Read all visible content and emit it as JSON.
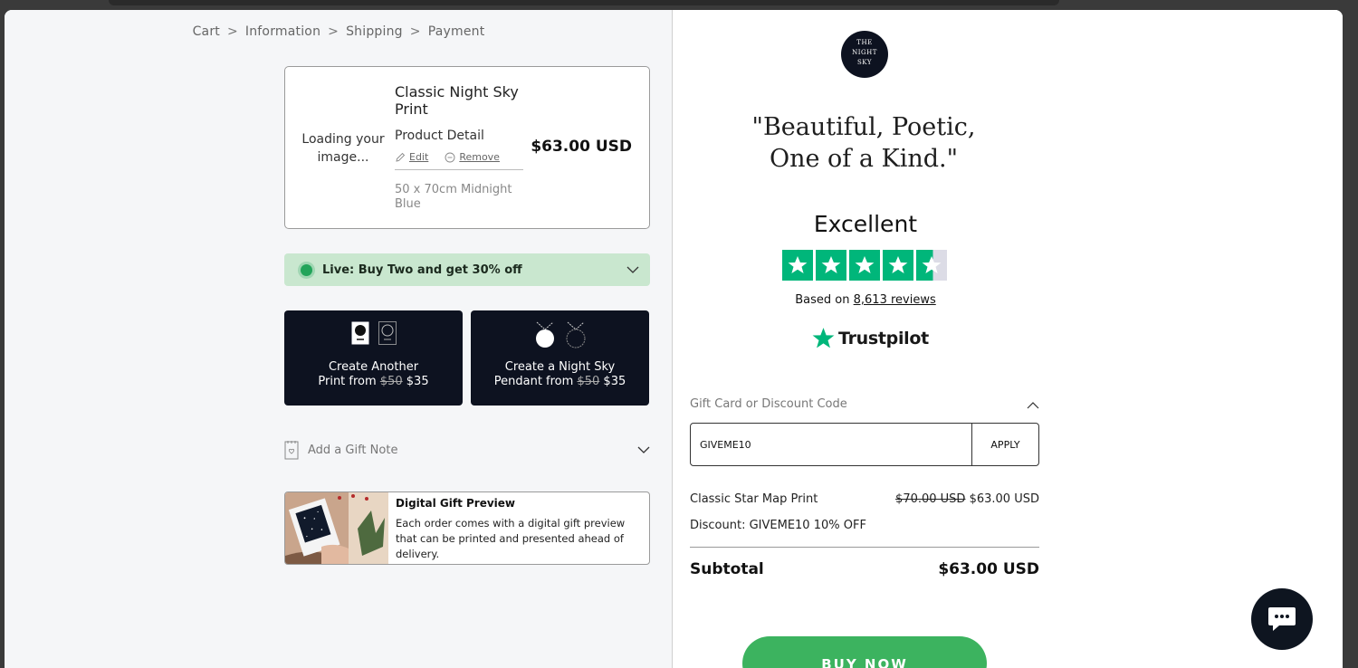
{
  "breadcrumb": {
    "items": [
      "Cart",
      "Information",
      "Shipping",
      "Payment"
    ],
    "separator": ">"
  },
  "product": {
    "loading_text": "Loading your image...",
    "title": "Classic Night Sky Print",
    "detail_label": "Product Detail",
    "edit_label": "Edit",
    "remove_label": "Remove",
    "variant": "50 x 70cm Midnight Blue",
    "price": "$63.00 USD"
  },
  "promo": {
    "label": "Live: Buy Two and get 30% off"
  },
  "upsells": [
    {
      "line1": "Create Another",
      "line2_prefix": "Print from",
      "old_price": "$50",
      "new_price": "$35"
    },
    {
      "line1": "Create a Night Sky",
      "line2_prefix": "Pendant from",
      "old_price": "$50",
      "new_price": "$35"
    }
  ],
  "gift_note": {
    "label": "Add a Gift Note"
  },
  "digital_preview": {
    "title": "Digital Gift Preview",
    "text": "Each order comes with a digital gift preview that can be printed and presented ahead of delivery."
  },
  "brand": {
    "logo_lines": [
      "THE",
      "NIGHT",
      "SKY"
    ],
    "quote_line1": "\"Beautiful, Poetic,",
    "quote_line2": "One of a Kind.\""
  },
  "reviews": {
    "rating_word": "Excellent",
    "stars": 4.5,
    "based_on_prefix": "Based on",
    "review_count_link": "8,613 reviews",
    "provider": "Trustpilot"
  },
  "discount": {
    "label": "Gift Card or Discount Code",
    "value": "GIVEME10",
    "apply_label": "APPLY"
  },
  "summary": {
    "item_name": "Classic Star Map Print",
    "item_old_price": "$70.00 USD",
    "item_new_price": "$63.00 USD",
    "discount_line": "Discount: GIVEME10 10% OFF",
    "subtotal_label": "Subtotal",
    "subtotal_value": "$63.00 USD"
  },
  "cta": {
    "buy_label": "BUY NOW"
  },
  "colors": {
    "accent_green": "#3cb35f",
    "trustpilot_green": "#00b67a",
    "dark_navy": "#0d1220",
    "promo_bg": "#c9e7cf"
  }
}
